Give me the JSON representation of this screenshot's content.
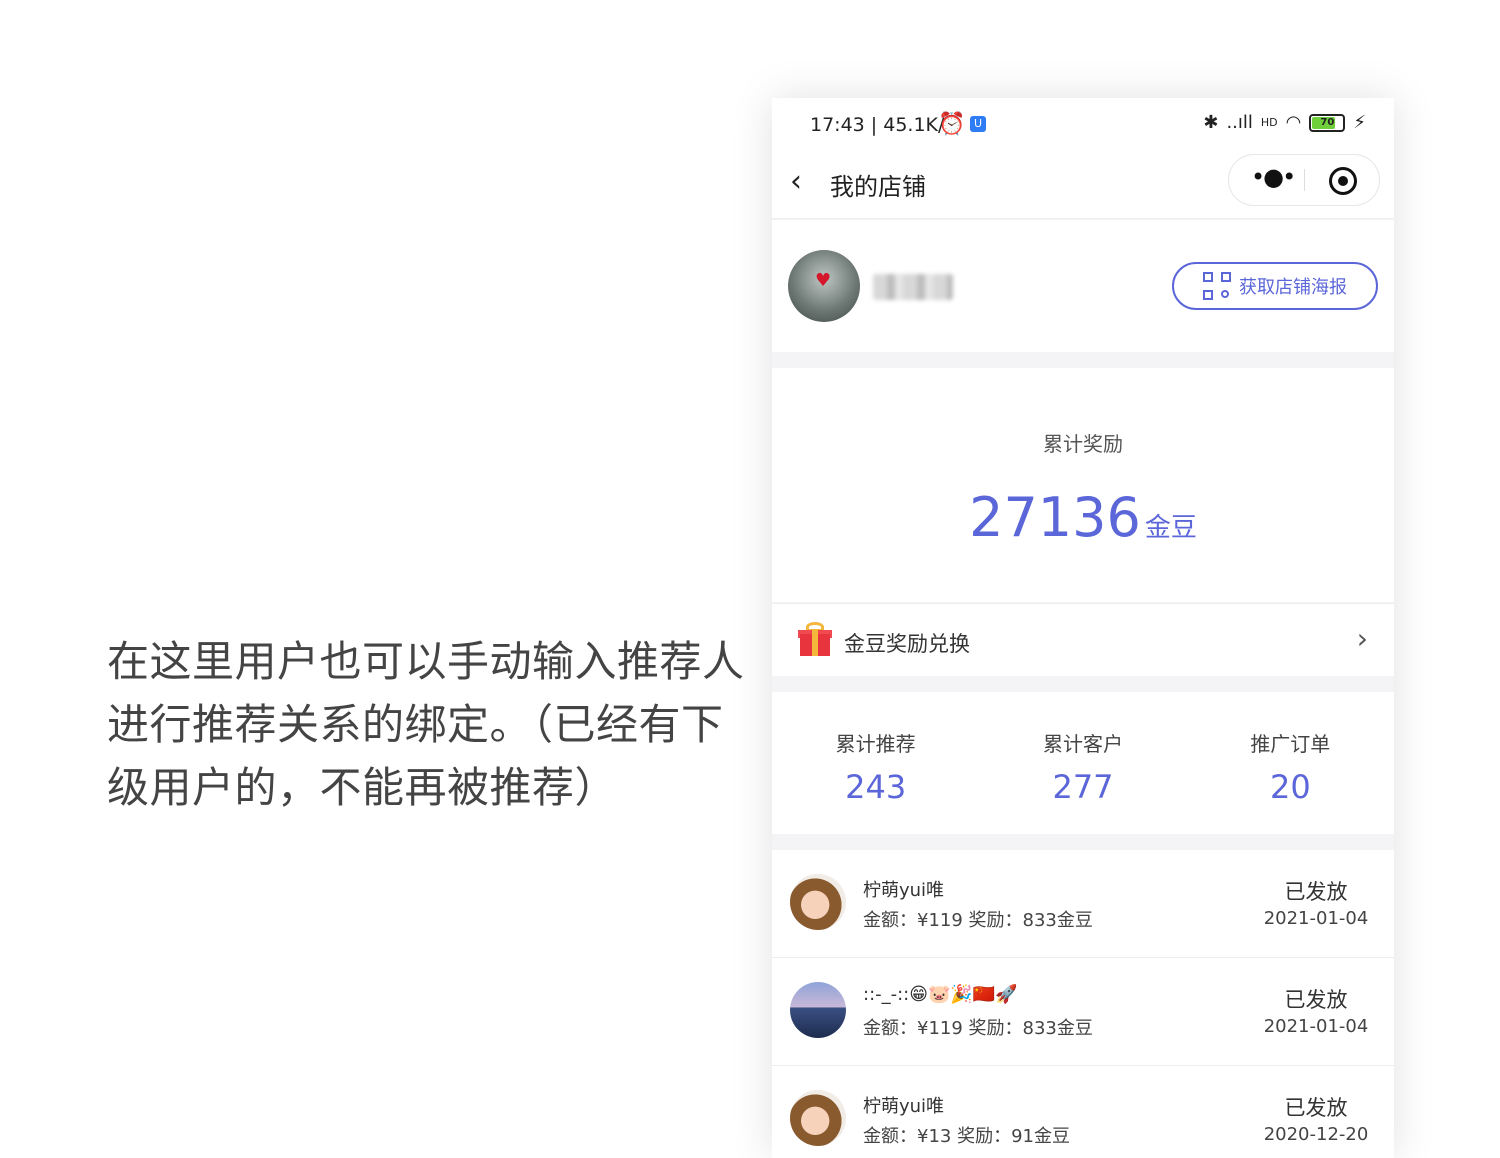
{
  "caption": {
    "line1": "在这里用户也可以手动输入推荐人",
    "line2": "进行推荐关系的绑定。（已经有下",
    "line3": "级用户的，不能再被推荐）"
  },
  "status_bar": {
    "time": "17:43 | 45.1K/s",
    "app_badge": "U",
    "signal1": "..ıll",
    "hd": "HD",
    "battery": "70"
  },
  "nav": {
    "back_icon": "chevron-left-icon",
    "title": "我的店铺",
    "more_icon": "more-dots-icon",
    "record_icon": "target-icon"
  },
  "profile": {
    "poster_button": "获取店铺海报"
  },
  "reward": {
    "label": "累计奖励",
    "amount": "27136",
    "unit": "金豆"
  },
  "exchange": {
    "label": "金豆奖励兑换",
    "chevron": "›"
  },
  "stats": [
    {
      "label": "累计推荐",
      "value": "243"
    },
    {
      "label": "累计客户",
      "value": "277"
    },
    {
      "label": "推广订单",
      "value": "20"
    }
  ],
  "orders": [
    {
      "name": "柠萌yui唯",
      "info": "金额：¥119  奖励：833金豆",
      "status": "已发放",
      "date": "2021-01-04"
    },
    {
      "name": "::-_-::😁🐷🎉🇨🇳🚀",
      "info": "金额：¥119  奖励：833金豆",
      "status": "已发放",
      "date": "2021-01-04"
    },
    {
      "name": "柠萌yui唯",
      "info": "金额：¥13  奖励：91金豆",
      "status": "已发放",
      "date": "2020-12-20"
    }
  ],
  "colors": {
    "accent": "#5b66d9",
    "background": "#f4f4f6"
  }
}
